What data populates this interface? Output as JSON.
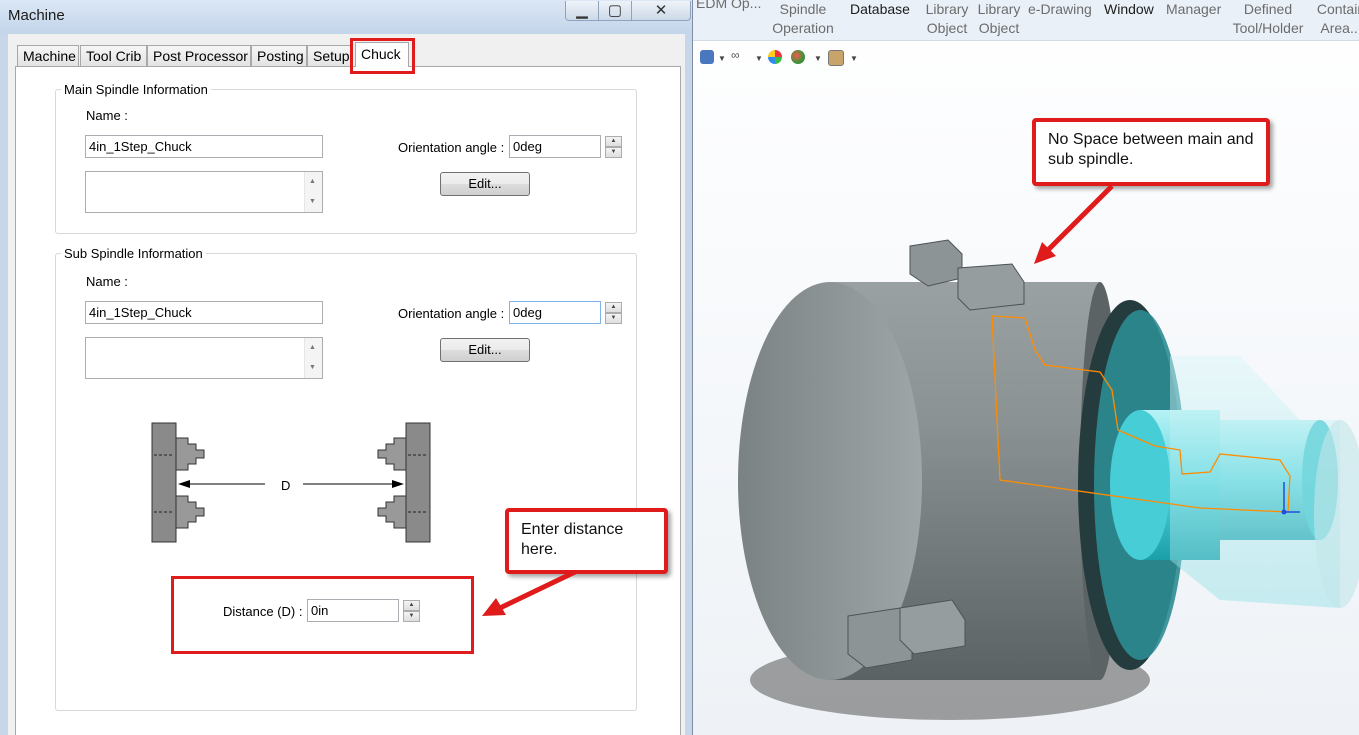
{
  "window": {
    "title": "Machine"
  },
  "tabs": [
    {
      "label": "Machine",
      "active": false
    },
    {
      "label": "Tool Crib",
      "active": false
    },
    {
      "label": "Post Processor",
      "active": false
    },
    {
      "label": "Posting",
      "active": false
    },
    {
      "label": "Setup",
      "active": false
    },
    {
      "label": "Chuck",
      "active": true
    }
  ],
  "main_spindle": {
    "group_label": "Main Spindle Information",
    "name_label": "Name :",
    "name_value": "4in_1Step_Chuck",
    "orientation_label": "Orientation angle :",
    "orientation_value": "0deg",
    "edit_label": "Edit..."
  },
  "sub_spindle": {
    "group_label": "Sub Spindle Information",
    "name_label": "Name :",
    "name_value": "4in_1Step_Chuck",
    "orientation_label": "Orientation angle :",
    "orientation_value": "0deg",
    "edit_label": "Edit..."
  },
  "diagram": {
    "distance_symbol": "D"
  },
  "distance": {
    "label": "Distance (D) :",
    "value": "0in"
  },
  "callouts": {
    "enter_distance": "Enter distance here.",
    "no_space": "No Space between main and sub spindle."
  },
  "ribbon": {
    "items": [
      "EDM Op...",
      "Spindle Operation",
      "Database",
      "Library Object",
      "Library Object",
      "e-Drawing",
      "Window",
      "Manager",
      "Defined Tool/Holder",
      "Contain Area..."
    ]
  },
  "colors": {
    "highlight_red": "#e01b1b",
    "chuck_gray": "#8e9596",
    "stock_cyan": "#38d0d8",
    "toolpath_orange": "#ff8c00"
  }
}
